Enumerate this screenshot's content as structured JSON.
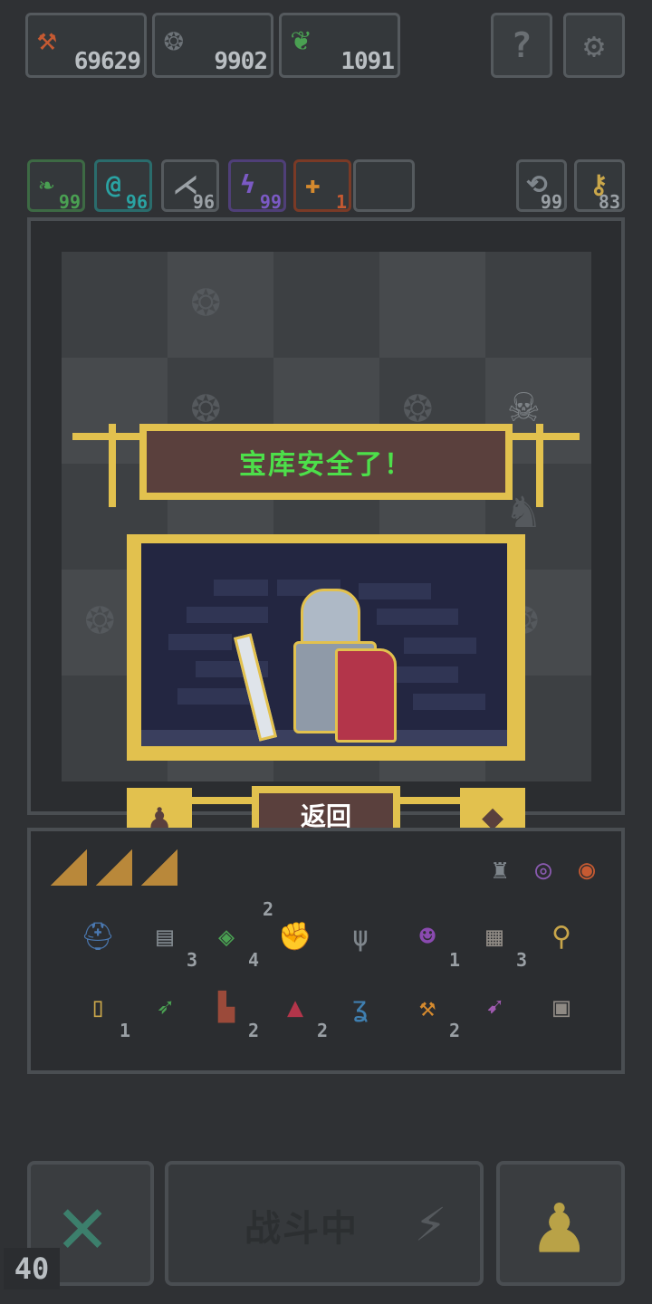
{
  "resources": [
    {
      "icon": "axe-icon",
      "value": "69629",
      "color": "#c9a64a"
    },
    {
      "icon": "curl-rock-icon",
      "value": "9902",
      "color": "#6d7378"
    },
    {
      "icon": "herb-icon",
      "value": "1091",
      "color": "#c9a64a"
    }
  ],
  "top_buttons": {
    "help_glyph": "?",
    "settings_glyph": "⚙"
  },
  "stats": [
    {
      "icon": "leaf-icon",
      "value": "99",
      "color": "#4aa052"
    },
    {
      "icon": "swirl-icon",
      "value": "96",
      "color": "#2aa3a3"
    },
    {
      "icon": "claw-icon",
      "value": "96",
      "color": "#9ba1a6"
    },
    {
      "icon": "bolt-icon",
      "value": "99",
      "color": "#7b5ac4"
    },
    {
      "icon": "fire-icon",
      "value": "1",
      "color": "#c65a32"
    }
  ],
  "counters": [
    {
      "icon": "refresh-icon",
      "value": "99"
    },
    {
      "icon": "key-icon",
      "value": "83"
    }
  ],
  "popup": {
    "title": "宝库安全了！",
    "back_label": "返回"
  },
  "inventory": {
    "row1": [
      {
        "icon": "helmet-icon",
        "qty": ""
      },
      {
        "icon": "scroll-icon",
        "qty": "3"
      },
      {
        "icon": "gem-icon",
        "qty": "4"
      },
      {
        "icon": "fist-icon",
        "qty": "2"
      },
      {
        "icon": "trident-icon",
        "qty": ""
      },
      {
        "icon": "demon-icon",
        "qty": "1"
      },
      {
        "icon": "map-icon",
        "qty": "3"
      },
      {
        "icon": "staff-icon",
        "qty": ""
      }
    ],
    "row2": [
      {
        "icon": "potion-icon",
        "qty": "1"
      },
      {
        "icon": "arrow-icon",
        "qty": ""
      },
      {
        "icon": "boot-icon",
        "qty": "2"
      },
      {
        "icon": "mask-icon",
        "qty": "2"
      },
      {
        "icon": "feather-icon",
        "qty": ""
      },
      {
        "icon": "battle-axe-icon",
        "qty": "2"
      },
      {
        "icon": "dart-icon",
        "qty": ""
      },
      {
        "icon": "chest-icon",
        "qty": ""
      }
    ]
  },
  "bottom_bar": {
    "battle_label": "战斗中",
    "fps": "40"
  }
}
